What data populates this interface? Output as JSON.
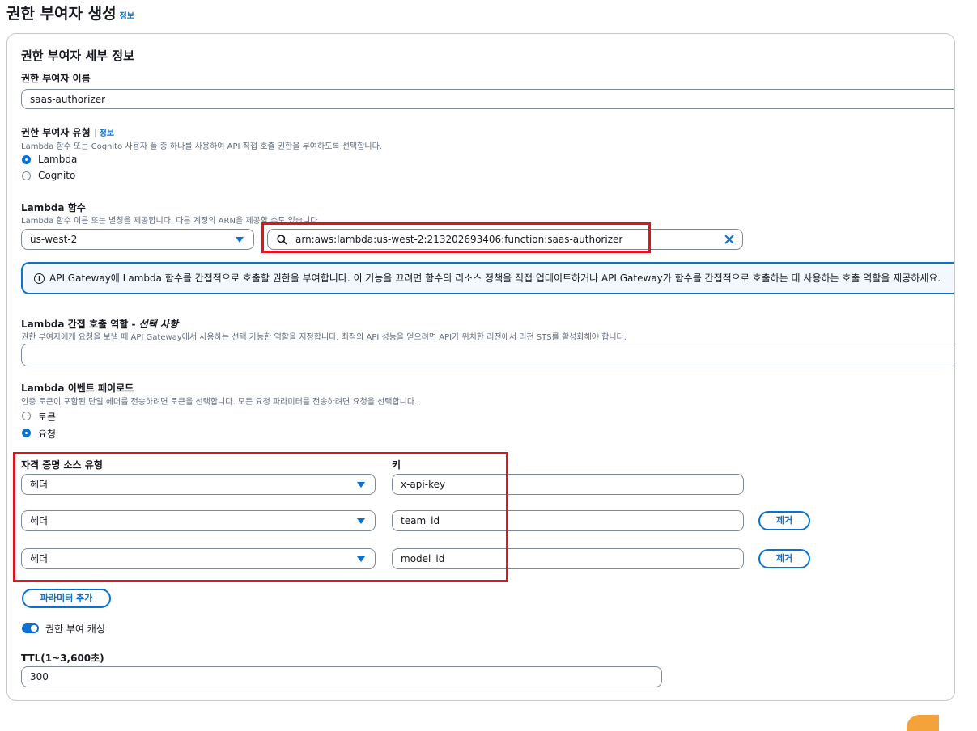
{
  "page": {
    "title": "권한 부여자 생성",
    "info_link": "정보"
  },
  "section": {
    "title": "권한 부여자 세부 정보"
  },
  "name_field": {
    "label": "권한 부여자 이름",
    "value": "saas-authorizer"
  },
  "type_field": {
    "label": "권한 부여자 유형",
    "info_link": "정보",
    "description": "Lambda 함수 또는 Cognito 사용자 풀 중 하나를 사용하여 API 직접 호출 권한을 부여하도록 선택합니다.",
    "options": [
      {
        "label": "Lambda",
        "selected": true
      },
      {
        "label": "Cognito",
        "selected": false
      }
    ]
  },
  "lambda_function": {
    "label": "Lambda 함수",
    "description": "Lambda 함수 이름 또는 별칭을 제공합니다. 다른 계정의 ARN을 제공할 수도 있습니다.",
    "region": "us-west-2",
    "arn": "arn:aws:lambda:us-west-2:213202693406:function:saas-authorizer"
  },
  "alert": {
    "text": "API Gateway에 Lambda 함수를 간접적으로 호출할 권한을 부여합니다. 이 기능을 끄려면 함수의 리소스 정책을 직접 업데이트하거나 API Gateway가 함수를 간접적으로 호출하는 데 사용하는 호출 역할을 제공하세요."
  },
  "invoke_role": {
    "label": "Lambda 간접 호출 역할 - ",
    "optional": "선택 사항",
    "description": "권한 부여자에게 요청을 보낼 때 API Gateway에서 사용하는 선택 가능한 역할을 지정합니다. 최적의 API 성능을 얻으려면 API가 위치한 리전에서 리전 STS를 활성화해야 합니다.",
    "value": ""
  },
  "event_payload": {
    "label": "Lambda 이벤트 페이로드",
    "description": "인증 토큰이 포함된 단일 헤더를 전송하려면 토큰을 선택합니다. 모든 요청 파라미터를 전송하려면 요청을 선택합니다.",
    "options": [
      {
        "label": "토큰",
        "selected": false
      },
      {
        "label": "요청",
        "selected": true
      }
    ]
  },
  "identity_sources": {
    "type_header": "자격 증명 소스 유형",
    "key_header": "키",
    "remove_label": "제거",
    "rows": [
      {
        "type": "헤더",
        "key": "x-api-key",
        "removable": false
      },
      {
        "type": "헤더",
        "key": "team_id",
        "removable": true
      },
      {
        "type": "헤더",
        "key": "model_id",
        "removable": true
      }
    ],
    "add_button": "파라미터 추가"
  },
  "caching": {
    "label": "권한 부여 캐싱",
    "enabled": true
  },
  "ttl": {
    "label": "TTL(1~3,600초)",
    "value": "300"
  },
  "colors": {
    "accent": "#0972d3",
    "highlight": "#e0141c",
    "border": "#7d8998"
  }
}
